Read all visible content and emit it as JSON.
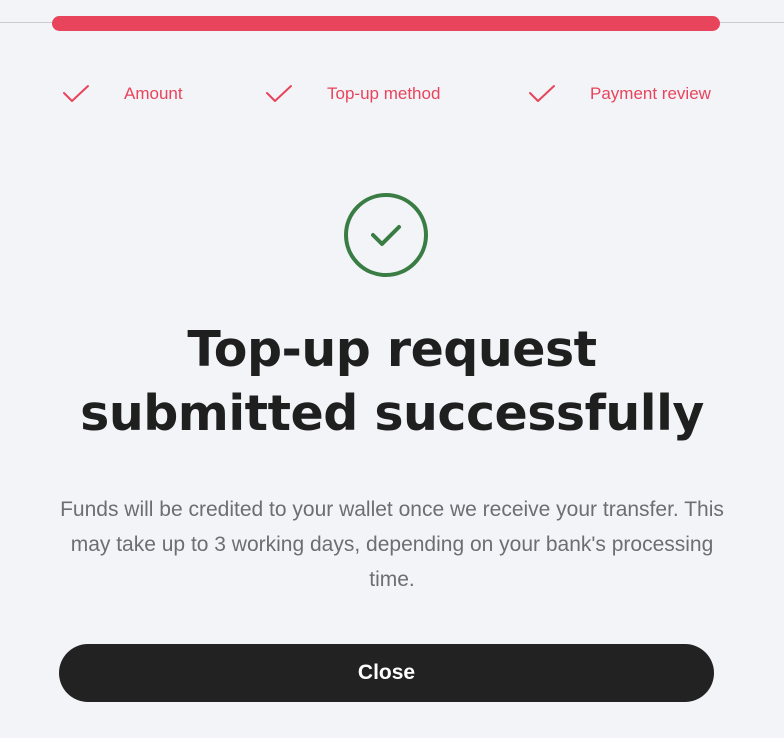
{
  "progress": {
    "completed_fraction": 1.0,
    "accent_color": "#e8445c"
  },
  "steps": [
    {
      "label": "Amount",
      "icon": "check-icon",
      "status": "completed"
    },
    {
      "label": "Top-up method",
      "icon": "check-icon",
      "status": "completed"
    },
    {
      "label": "Payment review",
      "icon": "check-icon",
      "status": "completed"
    }
  ],
  "result": {
    "icon": "success-check-circle-icon",
    "icon_color": "#3a7d44",
    "headline_line1": "Top-up request",
    "headline_line2": "submitted successfully",
    "description": "Funds will be credited to your wallet once we receive your transfer. This may take up to 3 working days, depending on your bank's processing time."
  },
  "actions": {
    "close_label": "Close"
  }
}
